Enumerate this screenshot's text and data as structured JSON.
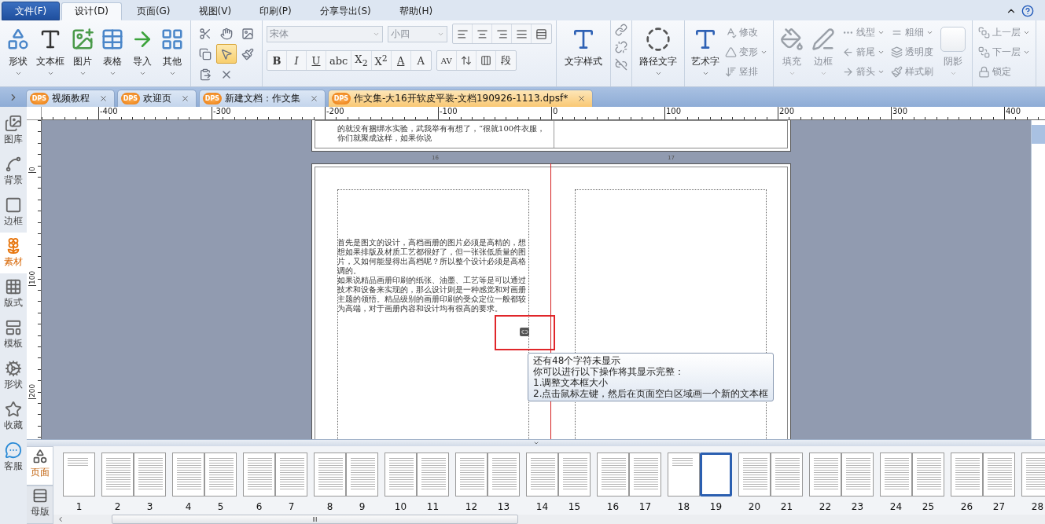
{
  "menu": {
    "items": [
      {
        "label": "文件(F)",
        "kind": "file",
        "selected": false
      },
      {
        "label": "设计(D)",
        "kind": "tab",
        "selected": true
      },
      {
        "label": "页面(G)",
        "kind": "tab",
        "selected": false
      },
      {
        "label": "视图(V)",
        "kind": "tab",
        "selected": false
      },
      {
        "label": "印刷(P)",
        "kind": "tab",
        "selected": false
      },
      {
        "label": "分享导出(S)",
        "kind": "tab",
        "selected": false
      },
      {
        "label": "帮助(H)",
        "kind": "tab",
        "selected": false
      }
    ]
  },
  "ribbon": {
    "insert": [
      {
        "label": "形状"
      },
      {
        "label": "文本框"
      },
      {
        "label": "图片"
      },
      {
        "label": "表格"
      },
      {
        "label": "导入"
      },
      {
        "label": "其他"
      }
    ],
    "edit_tools": [
      {
        "selected": false
      },
      {
        "selected": false
      },
      {
        "selected": false
      },
      {
        "selected": false
      },
      {
        "selected": true
      },
      {
        "selected": false
      },
      {
        "selected": false
      },
      {
        "selected": false
      }
    ],
    "font": {
      "family": "宋体",
      "size": "小四",
      "disabled": true
    },
    "format_buttons": [
      "B",
      "I",
      "U",
      "abc",
      "X$_{2}$",
      "X$^{2}$",
      "A",
      "A"
    ],
    "char_spacing": "AV",
    "paragraph_button": "段",
    "text_style": "文字样式",
    "path_text": "路径文字",
    "art_text": {
      "label": "艺术字",
      "options": [
        {
          "label": "修改",
          "dropdown": false,
          "disabled": true
        },
        {
          "label": "变形",
          "dropdown": true,
          "disabled": true
        },
        {
          "label": "竖排",
          "dropdown": false,
          "disabled": true
        }
      ]
    },
    "fill": [
      {
        "label": "填充",
        "disabled": true
      },
      {
        "label": "边框",
        "disabled": true
      }
    ],
    "line_options": [
      {
        "label": "线型",
        "dropdown": true,
        "disabled": true
      },
      {
        "label": "箭尾",
        "dropdown": true,
        "disabled": true
      },
      {
        "label": "箭头",
        "dropdown": true,
        "disabled": true
      }
    ],
    "style_options": [
      {
        "label": "粗细",
        "dropdown": true,
        "disabled": true
      },
      {
        "label": "透明度",
        "dropdown": false,
        "disabled": true
      },
      {
        "label": "样式刷",
        "dropdown": false,
        "disabled": true
      }
    ],
    "shadow": {
      "label": "阴影",
      "disabled": true
    },
    "layers": [
      {
        "label": "上一层",
        "dropdown": true,
        "disabled": true
      },
      {
        "label": "下一层",
        "dropdown": true,
        "disabled": true
      },
      {
        "label": "锁定",
        "dropdown": false,
        "disabled": true
      }
    ]
  },
  "doc_tabs": [
    {
      "badge": "DPS",
      "label": "视频教程",
      "selected": false
    },
    {
      "badge": "DPS",
      "label": "欢迎页",
      "selected": false
    },
    {
      "badge": "DPS",
      "label": "新建文档：作文集",
      "selected": false
    },
    {
      "badge": "DPS",
      "label": "作文集-大16开软皮平装-文档190926-1113.dpsf*",
      "selected": true
    }
  ],
  "sidebar": {
    "items": [
      {
        "label": "图库",
        "selected": false
      },
      {
        "label": "背景",
        "selected": false
      },
      {
        "label": "边框",
        "selected": false
      },
      {
        "label": "素材",
        "selected": true
      },
      {
        "label": "版式",
        "selected": false
      },
      {
        "label": "模板",
        "selected": false
      },
      {
        "label": "形状",
        "selected": false
      },
      {
        "label": "收藏",
        "selected": false
      },
      {
        "label": "客服",
        "selected": false
      }
    ]
  },
  "rulers": {
    "horizontal": [
      "-400",
      "-300",
      "-200",
      "-100",
      "0",
      "100",
      "200",
      "300",
      "400"
    ],
    "vertical": [
      "0",
      "100",
      "200"
    ]
  },
  "document": {
    "top_page_text": "的就没有捆绑水实验，武我举有有想了，“很就100件衣服，你们就聚成这样，如果你说",
    "page_numbers": [
      "16",
      "17"
    ],
    "paragraphs": [
      "首先是图文的设计，高档画册的图片必须是高精的，想想如果排版及材质工艺都很好了，但一张张低质量的图片，又如何能显得出高档呢？所以整个设计必须是高格调的。",
      "如果说精品画册印刷的纸张、油墨、工艺等是可以通过技术和设备来实现的，那么设计则是一种感觉和对画册主题的领悟。精品级别的画册印刷的受众定位一般都较为高端，对于画册内容和设计均有很高的要求。"
    ],
    "tooltip": [
      "还有48个字符未显示",
      "你可以进行以下操作将其显示完整：",
      "1.调整文本框大小",
      "2.点击鼠标左键，然后在页面空白区域画一个新的文本框"
    ]
  },
  "page_panel": {
    "tabs": [
      {
        "label": "页面",
        "selected": true
      },
      {
        "label": "母版",
        "selected": false
      }
    ],
    "spreads": [
      {
        "pages": [
          {
            "number": "1",
            "kind": "sparse",
            "selected": false
          }
        ]
      },
      {
        "pages": [
          {
            "number": "2",
            "kind": "full",
            "selected": false
          },
          {
            "number": "3",
            "kind": "full",
            "selected": false
          }
        ]
      },
      {
        "pages": [
          {
            "number": "4",
            "kind": "full",
            "selected": false
          },
          {
            "number": "5",
            "kind": "full",
            "selected": false
          }
        ]
      },
      {
        "pages": [
          {
            "number": "6",
            "kind": "full",
            "selected": false
          },
          {
            "number": "7",
            "kind": "full",
            "selected": false
          }
        ]
      },
      {
        "pages": [
          {
            "number": "8",
            "kind": "full",
            "selected": false
          },
          {
            "number": "9",
            "kind": "full",
            "selected": false
          }
        ]
      },
      {
        "pages": [
          {
            "number": "10",
            "kind": "full",
            "selected": false
          },
          {
            "number": "11",
            "kind": "full",
            "selected": false
          }
        ]
      },
      {
        "pages": [
          {
            "number": "12",
            "kind": "full",
            "selected": false
          },
          {
            "number": "13",
            "kind": "full",
            "selected": false
          }
        ]
      },
      {
        "pages": [
          {
            "number": "14",
            "kind": "full",
            "selected": false
          },
          {
            "number": "15",
            "kind": "full",
            "selected": false
          }
        ]
      },
      {
        "pages": [
          {
            "number": "16",
            "kind": "full",
            "selected": false
          },
          {
            "number": "17",
            "kind": "full",
            "selected": false
          }
        ]
      },
      {
        "pages": [
          {
            "number": "18",
            "kind": "sparse",
            "selected": false
          },
          {
            "number": "19",
            "kind": "blank",
            "selected": true
          }
        ]
      },
      {
        "pages": [
          {
            "number": "20",
            "kind": "full",
            "selected": false
          },
          {
            "number": "21",
            "kind": "full",
            "selected": false
          }
        ]
      },
      {
        "pages": [
          {
            "number": "22",
            "kind": "full",
            "selected": false
          },
          {
            "number": "23",
            "kind": "full",
            "selected": false
          }
        ]
      },
      {
        "pages": [
          {
            "number": "24",
            "kind": "full",
            "selected": false
          },
          {
            "number": "25",
            "kind": "full",
            "selected": false
          }
        ]
      },
      {
        "pages": [
          {
            "number": "26",
            "kind": "full",
            "selected": false
          },
          {
            "number": "27",
            "kind": "full",
            "selected": false
          }
        ]
      },
      {
        "pages": [
          {
            "number": "28",
            "kind": "full",
            "selected": false
          }
        ]
      }
    ]
  }
}
